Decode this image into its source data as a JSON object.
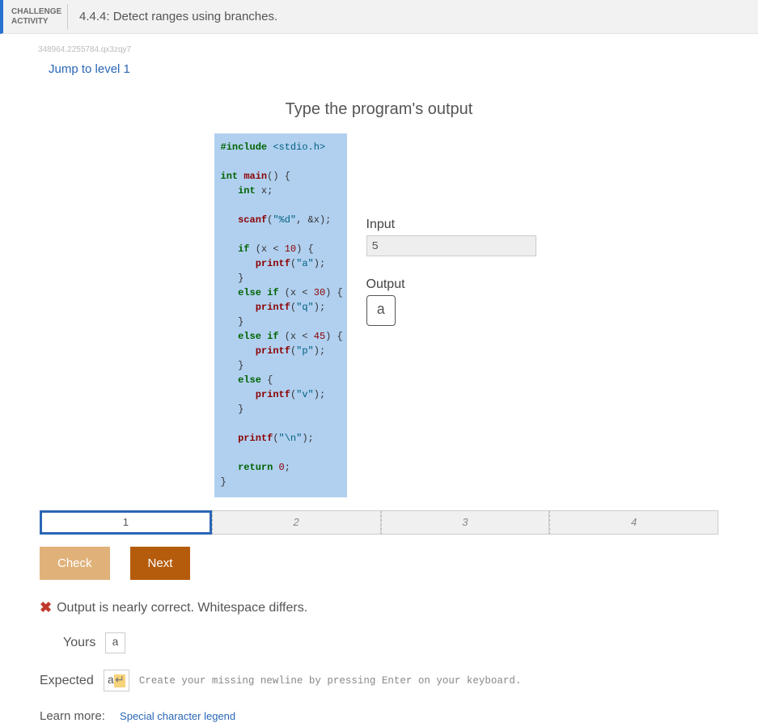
{
  "header": {
    "challenge_label_line1": "CHALLENGE",
    "challenge_label_line2": "ACTIVITY",
    "activity_title": "4.4.4: Detect ranges using branches."
  },
  "tiny_id": "348964.2255784.qx3zqy7",
  "jump_link": "Jump to level 1",
  "prompt": "Type the program's output",
  "code": {
    "l1a": "#include ",
    "l1b": "<stdio.h>",
    "l3a": "int ",
    "l3b": "main",
    "l3c": "() {",
    "l4a": "int",
    "l4b": " x;",
    "l6a": "scanf",
    "l6b": "(",
    "l6c": "\"%d\"",
    "l6d": ", &x);",
    "l8a": "if",
    "l8b": " (x < ",
    "l8c": "10",
    "l8d": ") {",
    "l9a": "printf",
    "l9b": "(",
    "l9c": "\"a\"",
    "l9d": ");",
    "l10": "}",
    "l11a": "else if",
    "l11b": " (x < ",
    "l11c": "30",
    "l11d": ") {",
    "l12a": "printf",
    "l12b": "(",
    "l12c": "\"q\"",
    "l12d": ");",
    "l13": "}",
    "l14a": "else if",
    "l14b": " (x < ",
    "l14c": "45",
    "l14d": ") {",
    "l15a": "printf",
    "l15b": "(",
    "l15c": "\"p\"",
    "l15d": ");",
    "l16": "}",
    "l17a": "else",
    "l17b": " {",
    "l18a": "printf",
    "l18b": "(",
    "l18c": "\"v\"",
    "l18d": ");",
    "l19": "}",
    "l21a": "printf",
    "l21b": "(",
    "l21c": "\"\\n\"",
    "l21d": ");",
    "l23a": "return ",
    "l23b": "0",
    "l23c": ";",
    "l24": "}"
  },
  "io": {
    "input_label": "Input",
    "input_value": "5",
    "output_label": "Output",
    "answer_value": "a"
  },
  "levels": [
    "1",
    "2",
    "3",
    "4"
  ],
  "buttons": {
    "check": "Check",
    "next": "Next"
  },
  "feedback": {
    "msg": "Output is nearly correct. Whitespace differs.",
    "yours_label": "Yours",
    "yours_value": "a",
    "expected_label": "Expected",
    "expected_value_char": "a",
    "expected_newline_glyph": "↵",
    "expected_hint": "Create your missing newline by pressing Enter on your keyboard."
  },
  "learn": {
    "label": "Learn more:",
    "link_text": "Special character legend"
  }
}
